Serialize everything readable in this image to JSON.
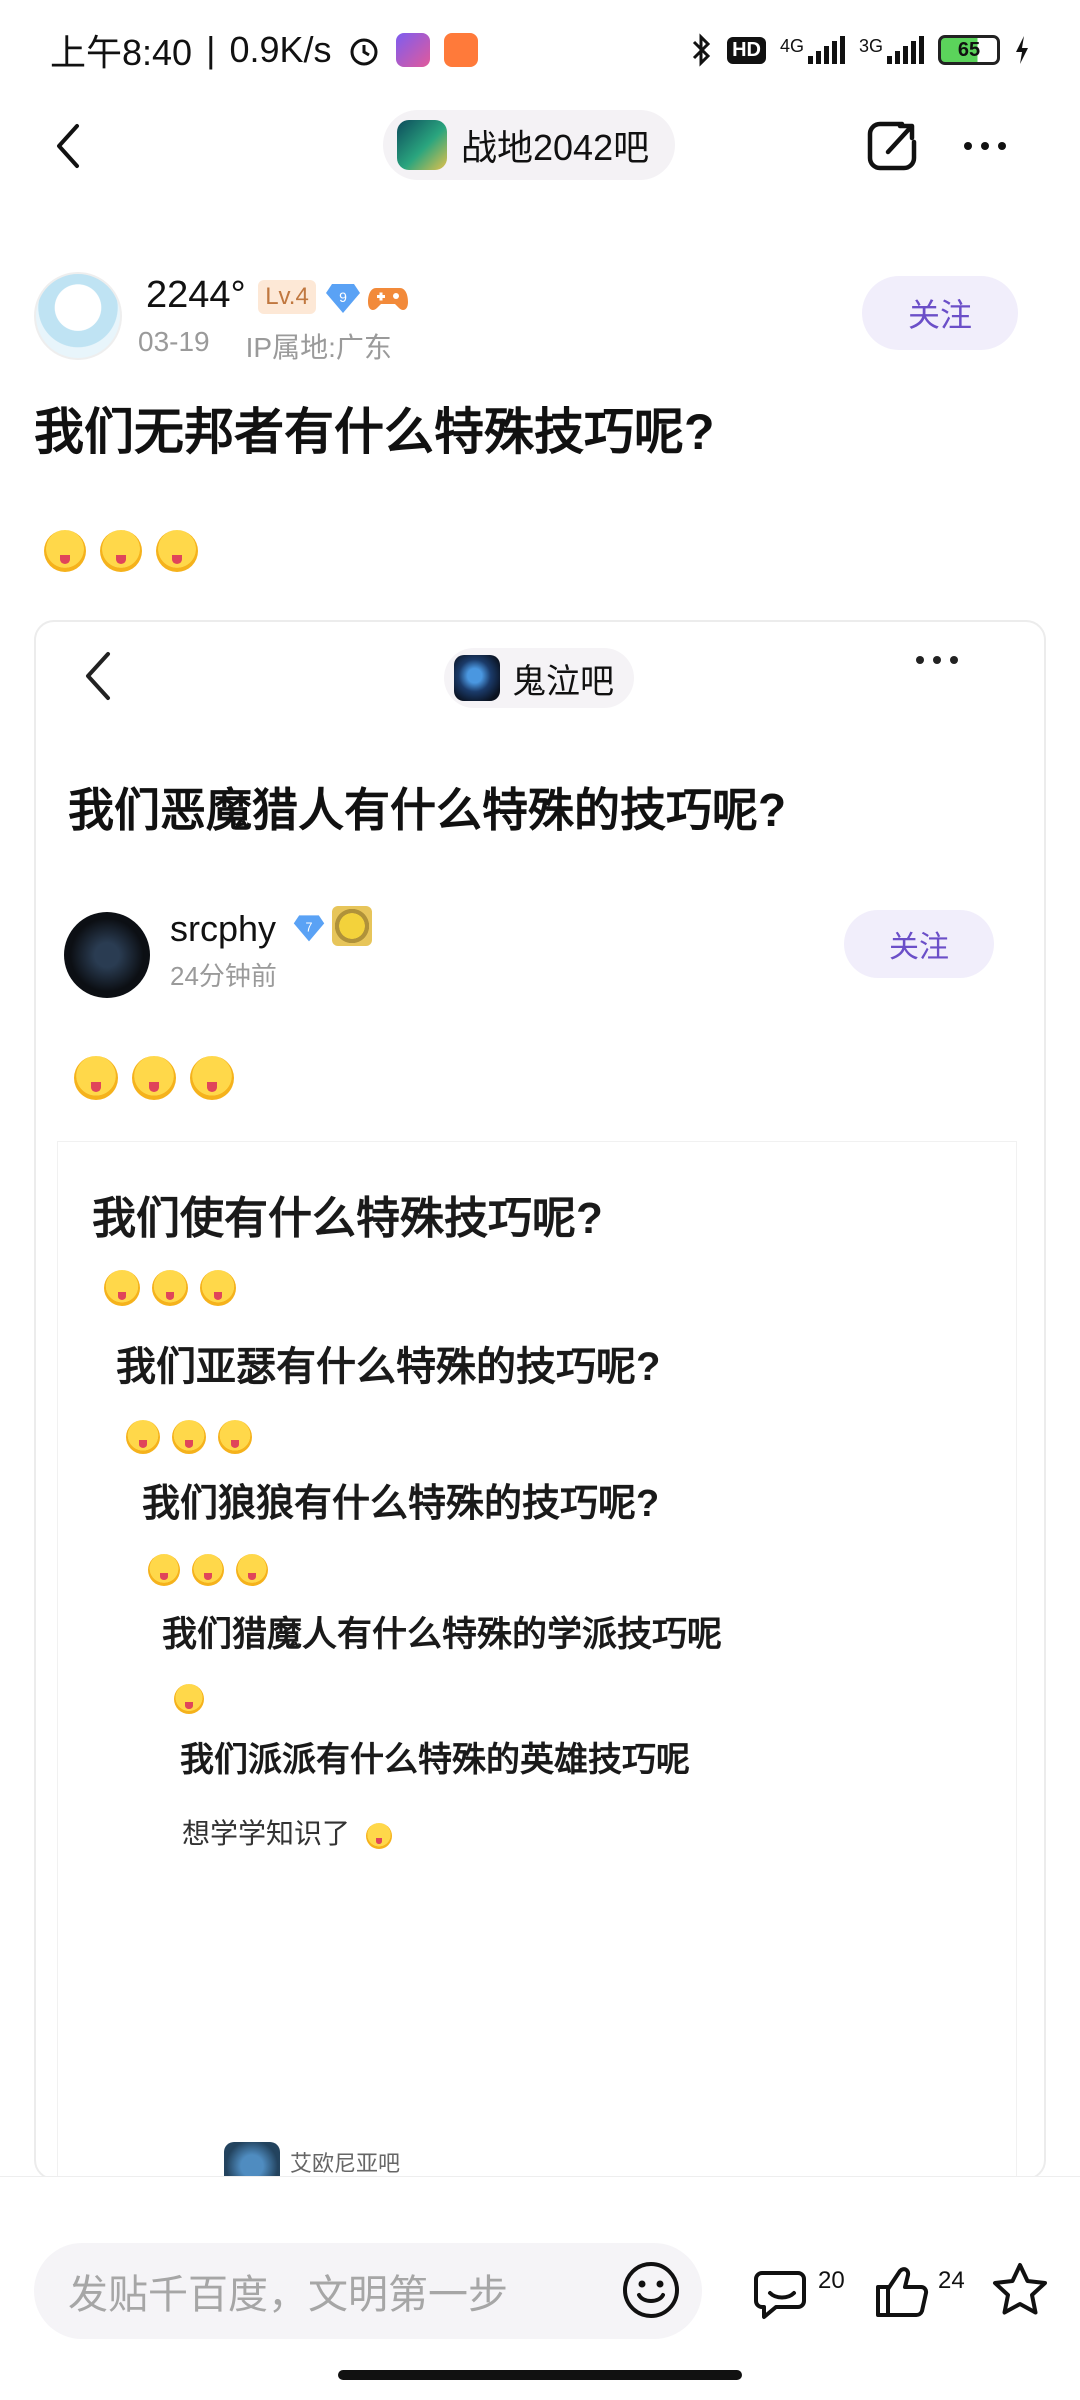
{
  "status_bar": {
    "time": "上午8:40",
    "net_speed": "0.9K/s",
    "battery": "65",
    "net_4g": "4G",
    "net_3g": "3G",
    "hd": "HD"
  },
  "nav": {
    "forum_name": "战地2042吧"
  },
  "author": {
    "name": "2244°",
    "level": "Lv.4",
    "badge_number": "9",
    "date": "03-19",
    "ip": "IP属地:广东",
    "follow_label": "关注"
  },
  "post": {
    "title": "我们无邦者有什么特殊技巧呢?"
  },
  "embedded": {
    "forum_name": "鬼泣吧",
    "title": "我们恶魔猎人有什么特殊的技巧呢?",
    "author_name": "srcphy",
    "author_badge": "7",
    "author_time": "24分钟前",
    "follow_label": "关注",
    "nested_lines": [
      "我们使有什么特殊技巧呢?",
      "我们亚瑟有什么特殊的技巧呢?",
      "我们狼狼有什么特殊的技巧呢?",
      "我们猎魔人有什么特殊的学派技巧呢",
      "我们派派有什么特殊的英雄技巧呢"
    ],
    "nested_small": "想学学知识了",
    "nested_footer": "艾欧尼亚吧"
  },
  "bottom_bar": {
    "reply_placeholder": "发贴千百度，文明第一步",
    "comment_count": "20",
    "like_count": "24"
  },
  "colors": {
    "accent": "#6b4fc8",
    "follow_bg": "#f1eefb",
    "level_bg": "#fde8d6"
  }
}
